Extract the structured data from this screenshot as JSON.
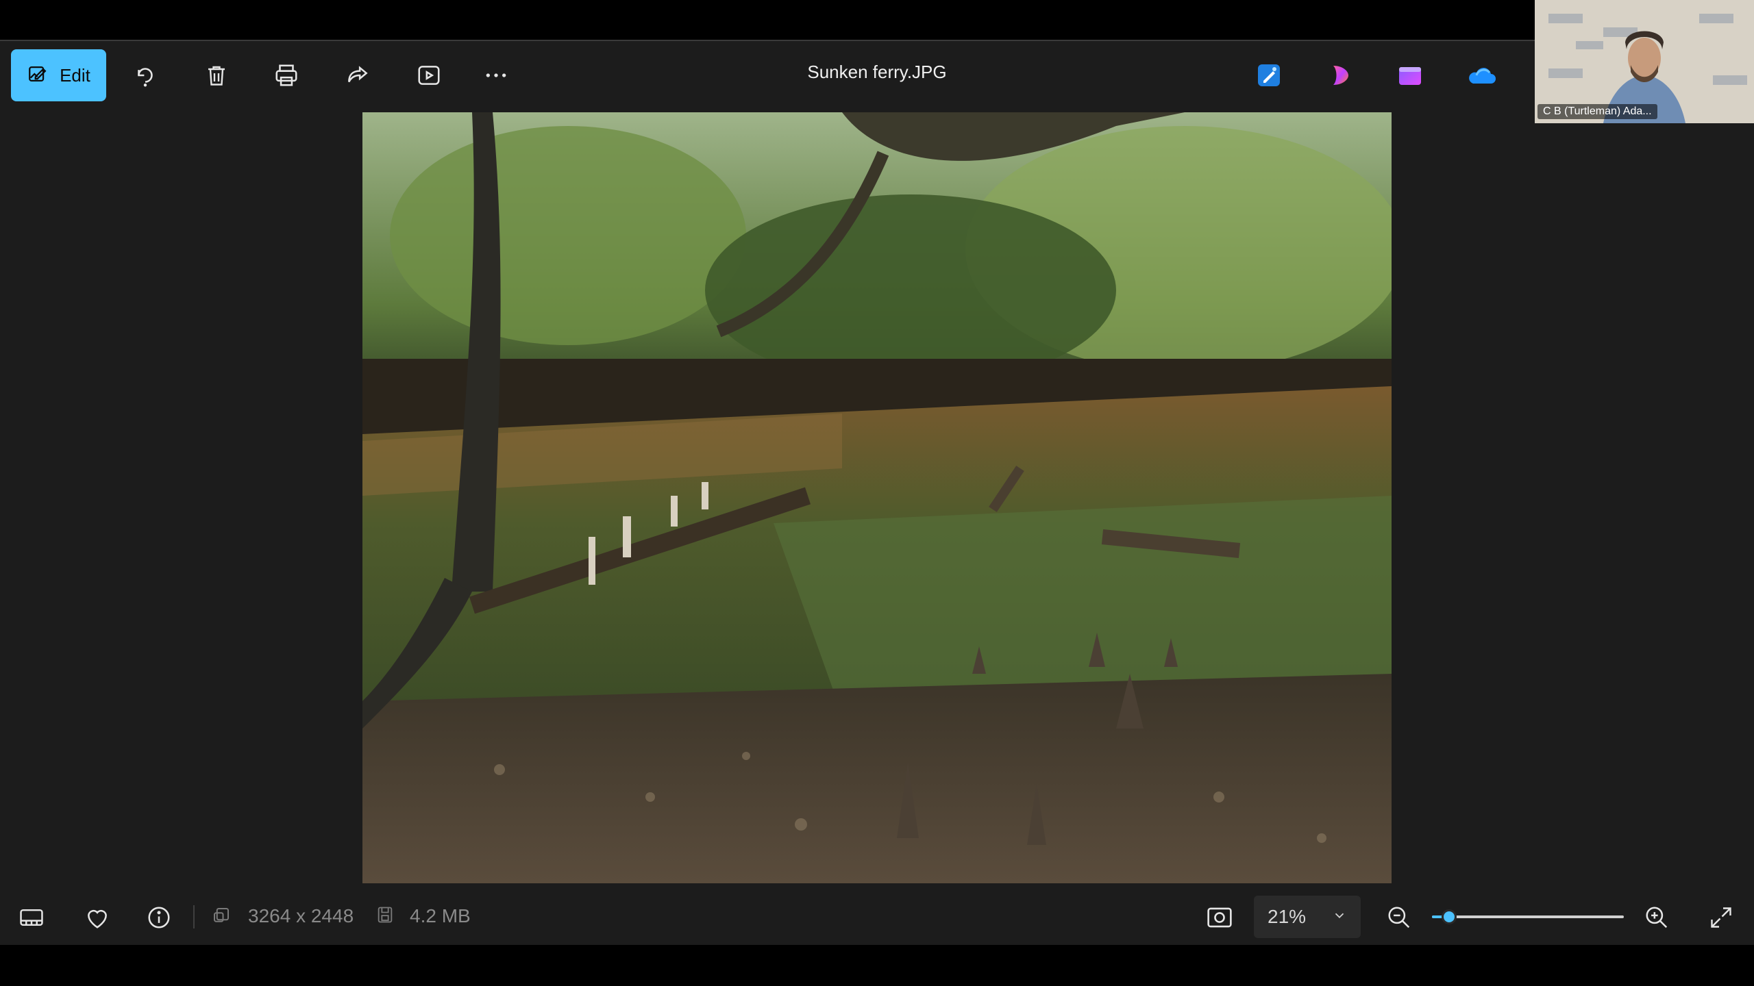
{
  "toolbar": {
    "edit_label": "Edit",
    "icons": [
      "edit-icon",
      "rotate-icon",
      "delete-icon",
      "print-icon",
      "share-icon",
      "slideshow-icon",
      "more-icon"
    ],
    "title": "Sunken ferry.JPG",
    "apps": [
      "designer-app-icon",
      "clipchamp-icon",
      "clipchamp-video-icon",
      "onedrive-icon"
    ]
  },
  "video_call": {
    "participant_name": "C B (Turtleman) Ada..."
  },
  "bottom_bar": {
    "dimensions": "3264 x 2448",
    "file_size": "4.2 MB",
    "zoom_value": "21%",
    "zoom_fraction": 0.09
  },
  "colors": {
    "accent": "#4cc2ff",
    "window_bg": "#1c1c1c"
  }
}
